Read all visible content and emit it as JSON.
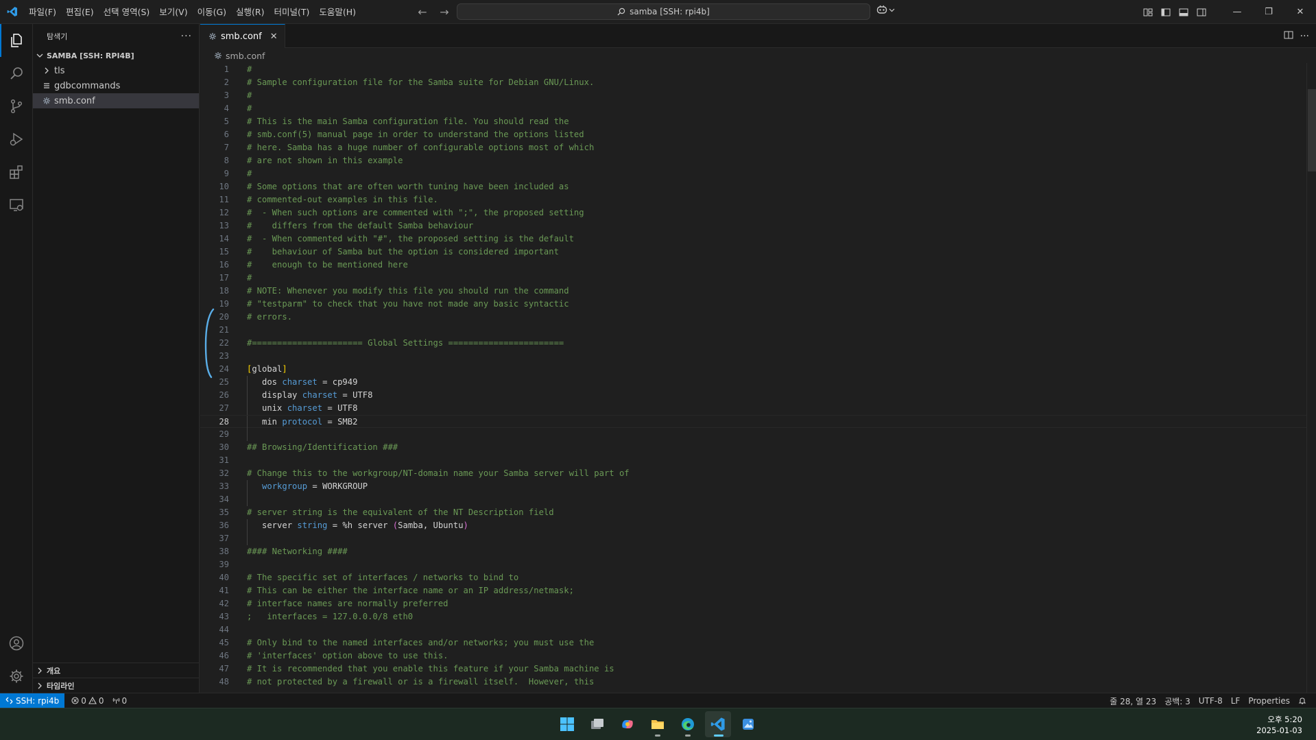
{
  "titlebar": {
    "menu": [
      "파일(F)",
      "편집(E)",
      "선택 영역(S)",
      "보기(V)",
      "이동(G)",
      "실행(R)",
      "터미널(T)",
      "도움말(H)"
    ],
    "search_text": "samba [SSH: rpi4b]"
  },
  "sidebar": {
    "title": "탐색기",
    "folder": "SAMBA [SSH: RPI4B]",
    "items": [
      {
        "label": "tls",
        "kind": "folder"
      },
      {
        "label": "gdbcommands",
        "kind": "file"
      },
      {
        "label": "smb.conf",
        "kind": "settings-file",
        "selected": true
      }
    ],
    "outline": "개요",
    "timeline": "타임라인"
  },
  "editor": {
    "tab_label": "smb.conf",
    "breadcrumb": "smb.conf",
    "current_line": 28,
    "lines": [
      {
        "n": "1",
        "t": [
          [
            "c",
            "#"
          ]
        ]
      },
      {
        "n": "2",
        "t": [
          [
            "c",
            "# Sample configuration file for the Samba suite for Debian GNU/Linux."
          ]
        ]
      },
      {
        "n": "3",
        "t": [
          [
            "c",
            "#"
          ]
        ]
      },
      {
        "n": "4",
        "t": [
          [
            "c",
            "#"
          ]
        ]
      },
      {
        "n": "5",
        "t": [
          [
            "c",
            "# This is the main Samba configuration file. You should read the"
          ]
        ]
      },
      {
        "n": "6",
        "t": [
          [
            "c",
            "# smb.conf(5) manual page in order to understand the options listed"
          ]
        ]
      },
      {
        "n": "7",
        "t": [
          [
            "c",
            "# here. Samba has a huge number of configurable options most of which"
          ]
        ]
      },
      {
        "n": "8",
        "t": [
          [
            "c",
            "# are not shown in this example"
          ]
        ]
      },
      {
        "n": "9",
        "t": [
          [
            "c",
            "#"
          ]
        ]
      },
      {
        "n": "10",
        "t": [
          [
            "c",
            "# Some options that are often worth tuning have been included as"
          ]
        ]
      },
      {
        "n": "11",
        "t": [
          [
            "c",
            "# commented-out examples in this file."
          ]
        ]
      },
      {
        "n": "12",
        "t": [
          [
            "c",
            "#  - When such options are commented with \";\", the proposed setting"
          ]
        ]
      },
      {
        "n": "13",
        "t": [
          [
            "c",
            "#    differs from the default Samba behaviour"
          ]
        ]
      },
      {
        "n": "14",
        "t": [
          [
            "c",
            "#  - When commented with \"#\", the proposed setting is the default"
          ]
        ]
      },
      {
        "n": "15",
        "t": [
          [
            "c",
            "#    behaviour of Samba but the option is considered important"
          ]
        ]
      },
      {
        "n": "16",
        "t": [
          [
            "c",
            "#    enough to be mentioned here"
          ]
        ]
      },
      {
        "n": "17",
        "t": [
          [
            "c",
            "#"
          ]
        ]
      },
      {
        "n": "18",
        "t": [
          [
            "c",
            "# NOTE: Whenever you modify this file you should run the command"
          ]
        ]
      },
      {
        "n": "19",
        "t": [
          [
            "c",
            "# \"testparm\" to check that you have not made any basic syntactic"
          ]
        ]
      },
      {
        "n": "20",
        "t": [
          [
            "c",
            "# errors."
          ]
        ]
      },
      {
        "n": "21",
        "t": []
      },
      {
        "n": "22",
        "t": [
          [
            "c",
            "#====================== Global Settings ======================="
          ]
        ]
      },
      {
        "n": "23",
        "t": []
      },
      {
        "n": "24",
        "t": [
          [
            "b",
            "["
          ],
          [
            "x",
            "global"
          ],
          [
            "b",
            "]"
          ]
        ]
      },
      {
        "n": "25",
        "t": [
          [
            "x",
            "   dos "
          ],
          [
            "k",
            "charset"
          ],
          [
            "x",
            " = cp949"
          ]
        ],
        "g": 1
      },
      {
        "n": "26",
        "t": [
          [
            "x",
            "   display "
          ],
          [
            "k",
            "charset"
          ],
          [
            "x",
            " = UTF8"
          ]
        ],
        "g": 1
      },
      {
        "n": "27",
        "t": [
          [
            "x",
            "   unix "
          ],
          [
            "k",
            "charset"
          ],
          [
            "x",
            " = UTF8"
          ]
        ],
        "g": 1
      },
      {
        "n": "28",
        "t": [
          [
            "x",
            "   min "
          ],
          [
            "k",
            "protocol"
          ],
          [
            "x",
            " = SMB2"
          ]
        ],
        "g": 1
      },
      {
        "n": "29",
        "t": [],
        "g": 1
      },
      {
        "n": "30",
        "t": [
          [
            "c",
            "## Browsing/Identification ###"
          ]
        ]
      },
      {
        "n": "31",
        "t": []
      },
      {
        "n": "32",
        "t": [
          [
            "c",
            "# Change this to the workgroup/NT-domain name your Samba server will part of"
          ]
        ]
      },
      {
        "n": "33",
        "t": [
          [
            "x",
            "   "
          ],
          [
            "k",
            "workgroup"
          ],
          [
            "x",
            " = WORKGROUP"
          ]
        ],
        "g": 1
      },
      {
        "n": "34",
        "t": [],
        "g": 1
      },
      {
        "n": "35",
        "t": [
          [
            "c",
            "# server string is the equivalent of the NT Description field"
          ]
        ]
      },
      {
        "n": "36",
        "t": [
          [
            "x",
            "   server "
          ],
          [
            "k",
            "string"
          ],
          [
            "x",
            " = %h server "
          ],
          [
            "p",
            "("
          ],
          [
            "x",
            "Samba, Ubuntu"
          ],
          [
            "p",
            ")"
          ]
        ],
        "g": 1
      },
      {
        "n": "37",
        "t": [],
        "g": 1
      },
      {
        "n": "38",
        "t": [
          [
            "c",
            "#### Networking ####"
          ]
        ]
      },
      {
        "n": "39",
        "t": []
      },
      {
        "n": "40",
        "t": [
          [
            "c",
            "# The specific set of interfaces / networks to bind to"
          ]
        ]
      },
      {
        "n": "41",
        "t": [
          [
            "c",
            "# This can be either the interface name or an IP address/netmask;"
          ]
        ]
      },
      {
        "n": "42",
        "t": [
          [
            "c",
            "# interface names are normally preferred"
          ]
        ]
      },
      {
        "n": "43",
        "t": [
          [
            "c",
            ";   interfaces = 127.0.0.0/8 eth0"
          ]
        ]
      },
      {
        "n": "44",
        "t": []
      },
      {
        "n": "45",
        "t": [
          [
            "c",
            "# Only bind to the named interfaces and/or networks; you must use the"
          ]
        ]
      },
      {
        "n": "46",
        "t": [
          [
            "c",
            "# 'interfaces' option above to use this."
          ]
        ]
      },
      {
        "n": "47",
        "t": [
          [
            "c",
            "# It is recommended that you enable this feature if your Samba machine is"
          ]
        ]
      },
      {
        "n": "48",
        "t": [
          [
            "c",
            "# not protected by a firewall or is a firewall itself.  However, this"
          ]
        ]
      }
    ]
  },
  "statusbar": {
    "remote": "SSH: rpi4b",
    "errors": "0",
    "warnings": "0",
    "ports": "0",
    "position": "줄 28, 열 23",
    "spaces": "공백: 3",
    "encoding": "UTF-8",
    "eol": "LF",
    "language": "Properties"
  },
  "taskbar": {
    "apps": [
      "start-icon",
      "task-view-icon",
      "copilot-icon",
      "file-explorer-icon",
      "edge-icon",
      "vscode-icon",
      "photos-icon"
    ],
    "time": "오후 5:20",
    "date": "2025-01-03"
  },
  "colors": {
    "accent": "#0078d4",
    "comment": "#6a9955",
    "keyword": "#569cd6"
  }
}
